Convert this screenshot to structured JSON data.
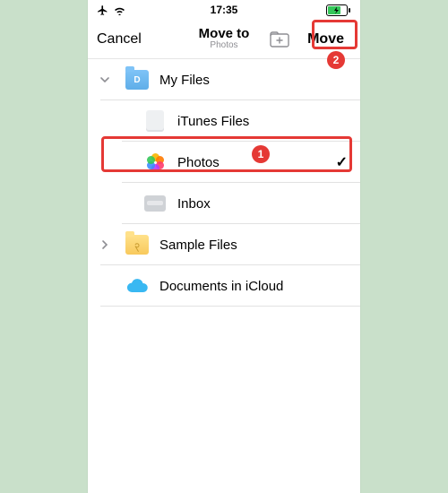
{
  "status": {
    "time": "17:35"
  },
  "nav": {
    "cancel": "Cancel",
    "title": "Move to",
    "subtitle": "Photos",
    "move": "Move"
  },
  "rows": {
    "myFiles": "My Files",
    "itunes": "iTunes Files",
    "photos": "Photos",
    "inbox": "Inbox",
    "sample": "Sample Files",
    "icloud": "Documents in iCloud"
  },
  "annotations": {
    "badge1": "1",
    "badge2": "2"
  }
}
